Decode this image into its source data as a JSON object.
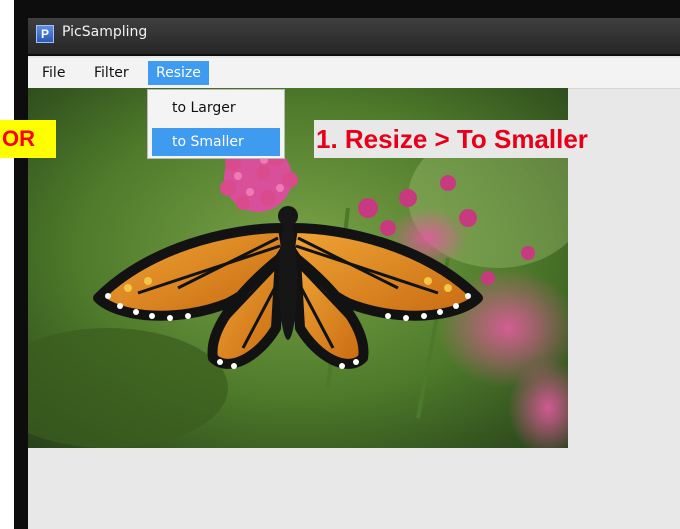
{
  "window": {
    "title": "PicSampling",
    "icon_glyph": "P"
  },
  "menubar": {
    "file": "File",
    "filter": "Filter",
    "resize": "Resize"
  },
  "resize_menu": {
    "items": [
      "to Larger",
      "to Smaller"
    ],
    "highlighted": "to Smaller"
  },
  "annotations": {
    "or_label": "OR",
    "step_label": "1. Resize > To Smaller"
  },
  "image": {
    "subject": "monarch butterfly on pink flowers"
  },
  "colors": {
    "menu_highlight": "#3e9bf0",
    "annotation_red": "#ff0000",
    "annotation_yellow": "#ffff00"
  }
}
